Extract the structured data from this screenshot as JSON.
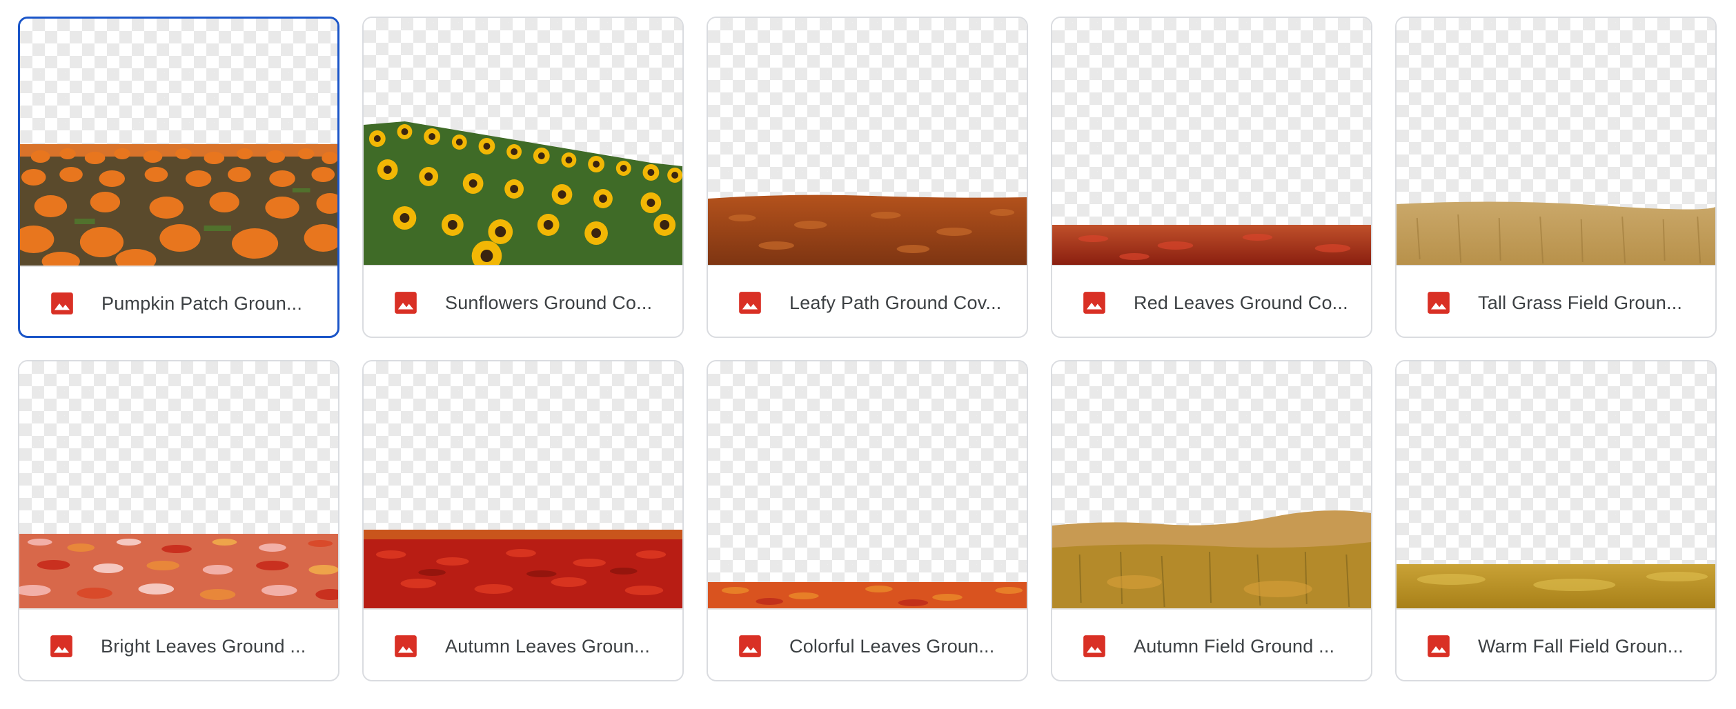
{
  "files": [
    {
      "name": "Pumpkin Patch Groun...",
      "icon": "image-file-icon"
    },
    {
      "name": "Sunflowers Ground Co...",
      "icon": "image-file-icon"
    },
    {
      "name": "Leafy Path Ground Cov...",
      "icon": "image-file-icon"
    },
    {
      "name": "Red Leaves Ground Co...",
      "icon": "image-file-icon"
    },
    {
      "name": "Tall Grass Field Groun...",
      "icon": "image-file-icon"
    },
    {
      "name": "Bright Leaves Ground ...",
      "icon": "image-file-icon"
    },
    {
      "name": "Autumn Leaves Groun...",
      "icon": "image-file-icon"
    },
    {
      "name": "Colorful Leaves Groun...",
      "icon": "image-file-icon"
    },
    {
      "name": "Autumn Field Ground ...",
      "icon": "image-file-icon"
    },
    {
      "name": "Warm Fall Field Groun...",
      "icon": "image-file-icon"
    }
  ],
  "colors": {
    "file_icon": "#d93025",
    "selected_border": "#1a55c8",
    "card_border": "#dadce0"
  }
}
